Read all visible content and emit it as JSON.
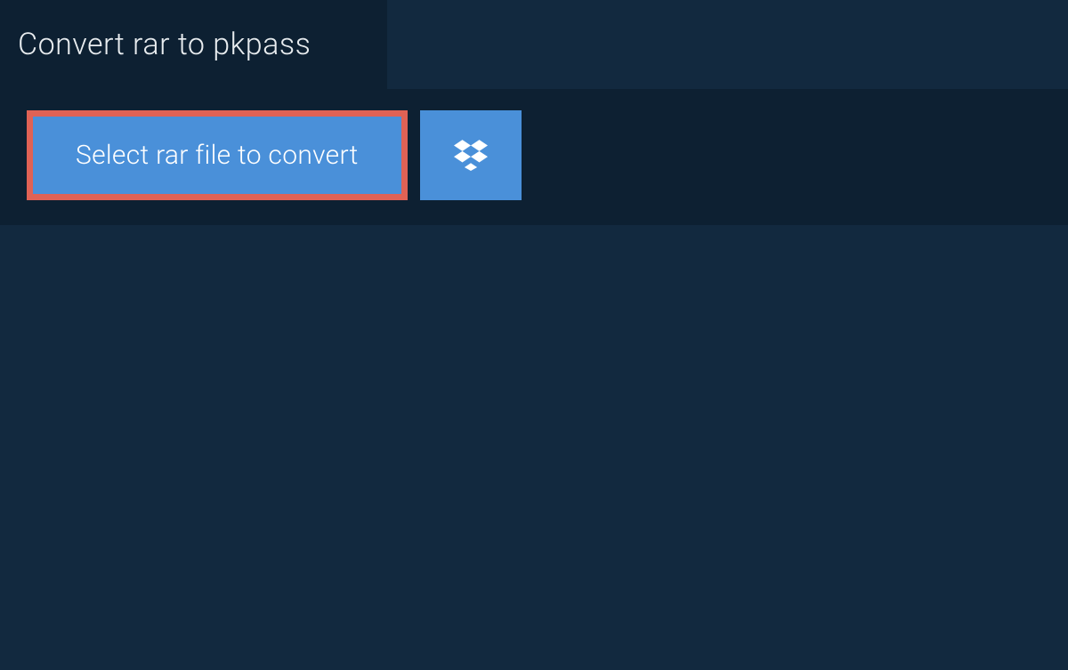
{
  "header": {
    "title": "Convert rar to pkpass"
  },
  "actions": {
    "select_file_label": "Select rar file to convert",
    "dropbox_icon": "dropbox-icon"
  },
  "colors": {
    "background": "#12293f",
    "panel": "#0d2032",
    "button": "#4a90d9",
    "highlight_border": "#e06255",
    "text_light": "#e8ecef"
  }
}
